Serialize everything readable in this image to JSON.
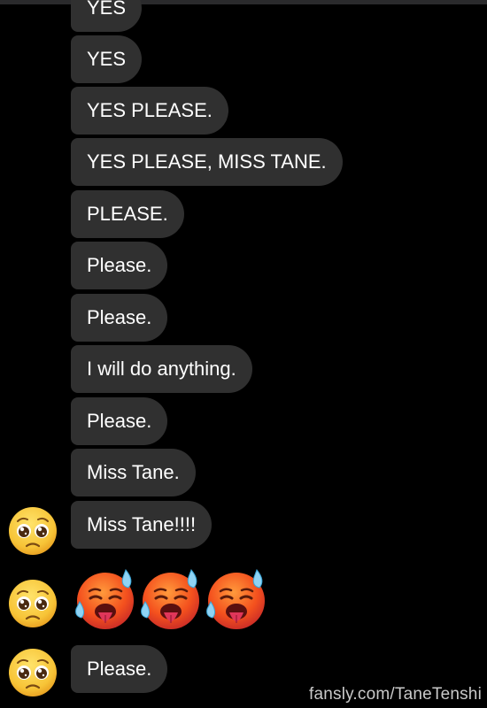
{
  "messages": [
    {
      "text": "YES"
    },
    {
      "text": "YES"
    },
    {
      "text": "YES PLEASE."
    },
    {
      "text": "YES PLEASE, MISS TANE."
    },
    {
      "text": "PLEASE."
    },
    {
      "text": "Please."
    },
    {
      "text": "Please."
    },
    {
      "text": "I will do anything."
    },
    {
      "text": "Please."
    },
    {
      "text": "Miss Tane."
    },
    {
      "text": "Miss Tane!!!!"
    },
    {
      "text": "Please."
    }
  ],
  "reaction_emojis": [
    "hot-face-sweat-icon",
    "hot-face-sweat-icon",
    "hot-face-sweat-icon"
  ],
  "avatar_emoji": "pleading-face-icon",
  "watermark": "fansly.com/TaneTenshi",
  "colors": {
    "background": "#000000",
    "bubble": "#303030",
    "text": "#ffffff"
  }
}
